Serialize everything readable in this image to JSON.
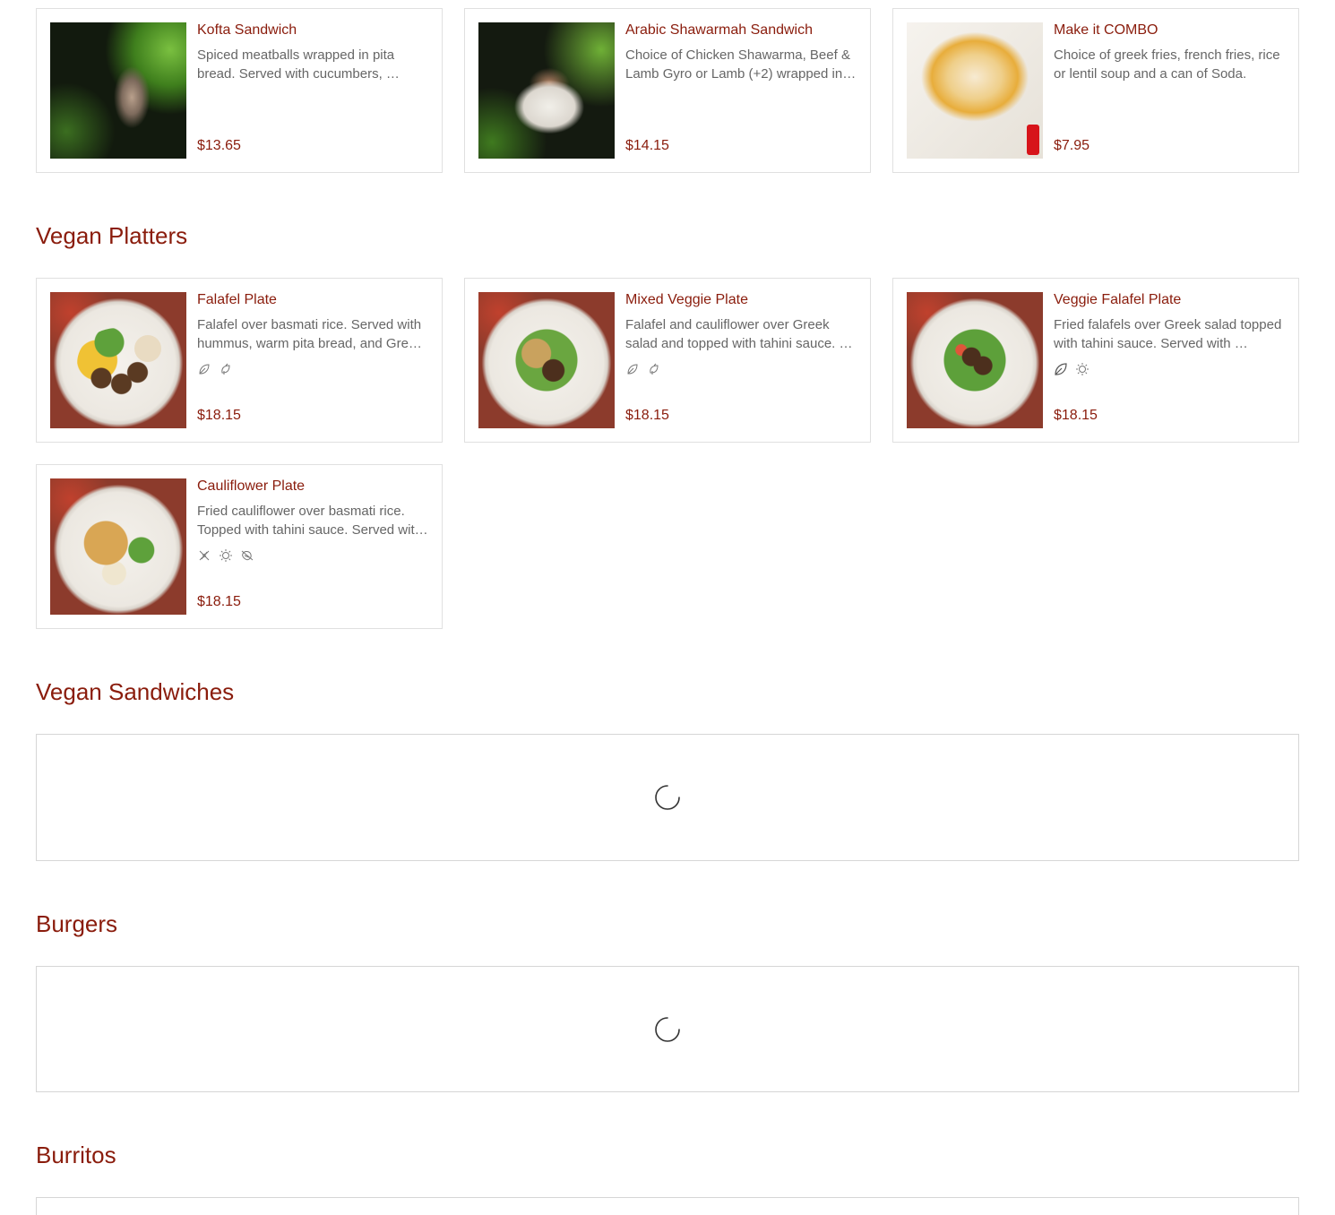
{
  "top_items": [
    {
      "name": "Kofta Sandwich",
      "description": "Spiced meatballs wrapped in pita bread. Served  with cucumbers, …",
      "price": "$13.65",
      "image": "kofta"
    },
    {
      "name": "Arabic Shawarmah Sandwich",
      "description": "Choice of Chicken Shawarma, Beef & Lamb Gyro or Lamb (+2) wrapped in…",
      "price": "$14.15",
      "image": "shawarma"
    },
    {
      "name": "Make it COMBO",
      "description": "Choice of greek fries, french fries, rice or lentil soup and a can of Soda.",
      "price": "$7.95",
      "image": "combo"
    }
  ],
  "sections": {
    "vegan_platters": {
      "title": "Vegan Platters"
    },
    "vegan_sandwiches": {
      "title": "Vegan Sandwiches"
    },
    "burgers": {
      "title": "Burgers"
    },
    "burritos": {
      "title": "Burritos"
    }
  },
  "vegan_items": [
    {
      "name": "Falafel Plate",
      "description": "Falafel over basmati rice. Served with hummus, warm pita bread, and Gre…",
      "price": "$18.15",
      "tags": [
        "vegan-leaf-icon",
        "vegetarian-leaf-icon"
      ]
    },
    {
      "name": "Mixed Veggie Plate",
      "description": "Falafel and cauliflower over Greek salad and topped with tahini sauce. …",
      "price": "$18.15",
      "tags": [
        "vegan-leaf-icon",
        "vegetarian-leaf-icon"
      ]
    },
    {
      "name": "Veggie Falafel Plate",
      "description": "Fried falafels over Greek salad topped with tahini sauce. Served with …",
      "price": "$18.15",
      "tags": [
        "vegan-leaf-icon",
        "sun-icon"
      ]
    },
    {
      "name": "Cauliflower Plate",
      "description": "Fried cauliflower over basmati rice. Topped with tahini sauce. Served wit…",
      "price": "$18.15",
      "tags": [
        "no-gluten-icon",
        "sun-icon",
        "nut-free-icon"
      ]
    }
  ],
  "colors": {
    "accent": "#8a1c0c",
    "text": "#666666",
    "border": "#e0e0e0"
  }
}
